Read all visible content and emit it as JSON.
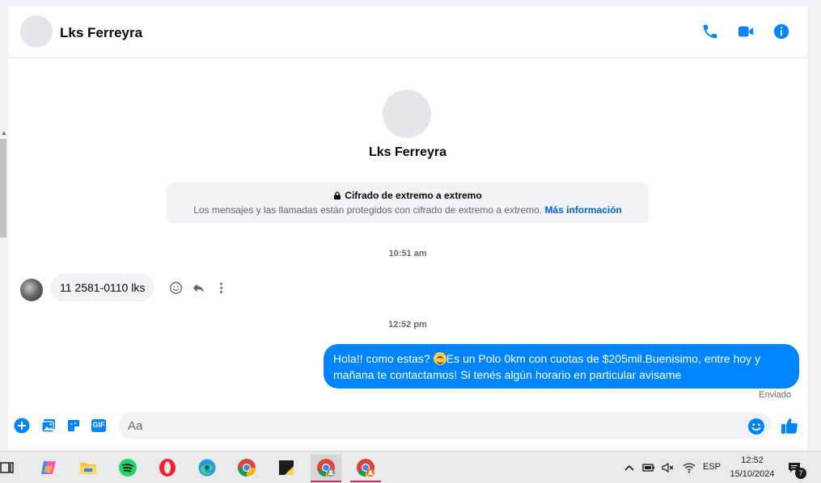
{
  "header": {
    "contact_name": "Lks Ferreyra",
    "icons": [
      "phone-icon",
      "video-camera-icon",
      "info-icon"
    ],
    "accent_color": "#0084ff"
  },
  "intro": {
    "name": "Lks Ferreyra",
    "e2e_title": "Cifrado de extremo a extremo",
    "e2e_description": "Los mensajes y las llamadas están protegidos con cifrado de extremo a extremo.",
    "e2e_link": "Más información"
  },
  "messages": [
    {
      "timestamp": "10:51 am",
      "direction": "incoming",
      "text": "11 2581-0110 lks"
    },
    {
      "timestamp": "12:52 pm",
      "direction": "outgoing",
      "text_before_emoji": "Hola!! como estas? ",
      "emoji": "smiling-face-emoji",
      "text_after_emoji": "Es un Polo 0km con cuotas de $205mil.Buenisimo, entre hoy y mañana te contactamos! Si tenés algún horario en particular avisame",
      "status": "Enviado"
    }
  ],
  "composer": {
    "placeholder": "Aa",
    "icons": [
      "add-icon",
      "image-icon",
      "sticker-icon",
      "gif-icon",
      "emoji-icon",
      "thumbs-up-icon"
    ],
    "gif_label": "GIF"
  },
  "taskbar": {
    "apps": [
      "task-view-icon",
      "copilot-icon",
      "file-explorer-icon",
      "spotify-icon",
      "opera-icon",
      "edge-icon",
      "chrome-icon",
      "sticky-notes-icon",
      "chrome-profile-icon",
      "chrome-profile-2-icon"
    ],
    "language": "ESP",
    "time": "12:52",
    "date": "15/10/2024",
    "notification_count": "7"
  }
}
